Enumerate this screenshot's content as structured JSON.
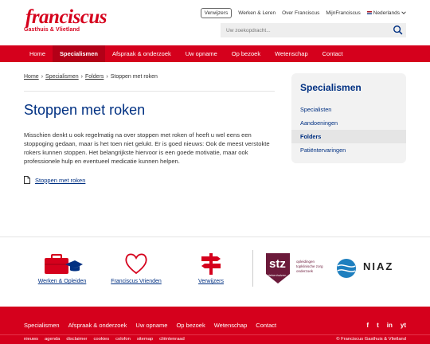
{
  "header": {
    "logo_text": "franciscus",
    "logo_subtext": "Gasthuis & Vlietland",
    "toplinks": [
      "Verwijzers",
      "Werken & Leren",
      "Over Franciscus",
      "MijnFranciscus"
    ],
    "language": "Nederlands",
    "search_placeholder": "Uw zoekopdracht..."
  },
  "nav": {
    "items": [
      "Home",
      "Specialismen",
      "Afspraak & onderzoek",
      "Uw opname",
      "Op bezoek",
      "Wetenschap",
      "Contact"
    ],
    "active": "Specialismen"
  },
  "breadcrumb": [
    "Home",
    "Specialismen",
    "Folders",
    "Stoppen met roken"
  ],
  "main": {
    "title": "Stoppen met roken",
    "intro": "Misschien denkt u ook regelmatig na over stoppen met roken of heeft u wel eens een stoppoging gedaan, maar is het toen niet gelukt. Er is goed nieuws: Ook de meest verstokte rokers kunnen stoppen. Het belangrijkste hiervoor is een goede motivatie, maar ook professionele hulp en eventueel medicatie kunnen helpen.",
    "doc_link": "Stoppen met roken"
  },
  "sidebar": {
    "title": "Specialismen",
    "items": [
      "Specialisten",
      "Aandoeningen",
      "Folders",
      "Patiëntervaringen"
    ],
    "active": "Folders"
  },
  "partners": {
    "items": [
      "Werken & Opleiden",
      "Franciscus Vrienden",
      "Verwijzers"
    ],
    "stz_logo_text": "stz",
    "stz_sub": "ziekenhuizen",
    "stz_tagline": [
      "opleidingen",
      "topklinische zorg",
      "onderzoek"
    ],
    "niaz_text": "NIAZ"
  },
  "footer": {
    "nav": [
      "Specialismen",
      "Afspraak & onderzoek",
      "Uw opname",
      "Op bezoek",
      "Wetenschap",
      "Contact"
    ],
    "sub": [
      "nieuws",
      "agenda",
      "disclaimer",
      "cookies",
      "colofon",
      "sitemap",
      "cliëntenraad"
    ],
    "copyright": "© Franciscus Gasthuis & Vlietland",
    "social": [
      "f",
      "t",
      "in",
      "yt"
    ]
  },
  "colors": {
    "brand_red": "#d5001c",
    "brand_blue": "#003082"
  }
}
